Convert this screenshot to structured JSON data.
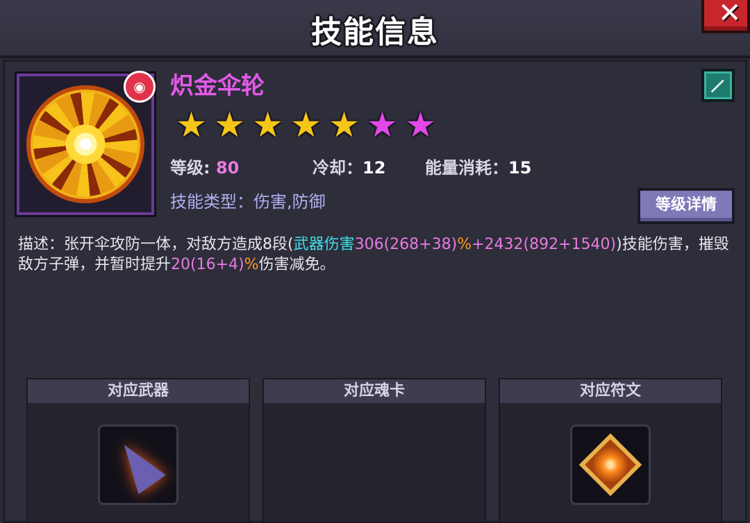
{
  "window": {
    "title": "技能信息",
    "close_label": "✕"
  },
  "skill": {
    "name": "炽金伞轮",
    "badge": "◉",
    "stars": {
      "gold": 5,
      "purple": 2,
      "total": 7
    },
    "star_colors": {
      "gold": "#f5c518",
      "purple": "#e048e8"
    },
    "level_label": "等级:",
    "level_value": "80",
    "cooldown_label": "冷却：",
    "cooldown_value": "12",
    "energy_label": "能量消耗：",
    "energy_value": "15",
    "type_text": "技能类型：伤害,防御",
    "detail_button": "等级详情",
    "edit_icon": "sword-edit-icon"
  },
  "description": {
    "p1": "描述：张开伞攻防一体，对敌方造成8段(",
    "p2": "武器伤害",
    "p3": "306(268+38)",
    "p4": "%",
    "p5": "+2432(892+1540)",
    "p6": ")技能伤害，摧毁敌方子弹，并暂时提升",
    "p7": "20(16+4)",
    "p8": "%",
    "p9": "伤害减免。"
  },
  "cards": [
    {
      "title": "对应武器",
      "item": "umbrella-weapon-icon"
    },
    {
      "title": "对应魂卡",
      "item": ""
    },
    {
      "title": "对应符文",
      "item": "rune-icon"
    }
  ],
  "colors": {
    "cyan": "#3fe0e8",
    "orange": "#ff9a20",
    "magenta": "#e77be0",
    "skill_name": "#e25be8"
  }
}
